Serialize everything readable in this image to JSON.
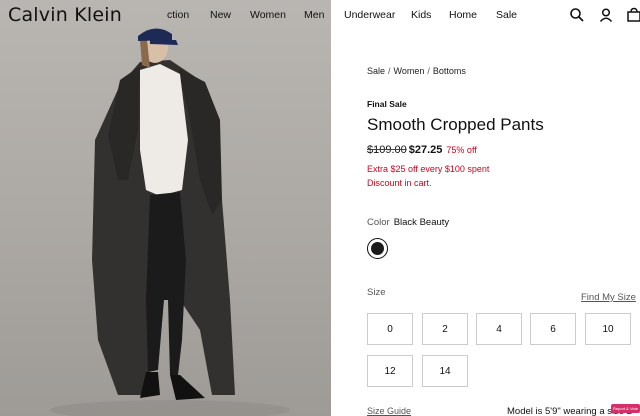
{
  "header": {
    "logo": "Calvin Klein",
    "nav": [
      "ction",
      "New",
      "Women",
      "Men",
      "Underwear",
      "Kids",
      "Home",
      "Sale"
    ]
  },
  "icons": {
    "search": "search-icon",
    "account": "user-icon",
    "cart": "bag-icon"
  },
  "product": {
    "breadcrumb": [
      "Sale",
      "Women",
      "Bottoms"
    ],
    "badge": "Final Sale",
    "title": "Smooth Cropped Pants",
    "price_old": "$109.00",
    "price_new": "$27.25",
    "discount": "75% off",
    "promo_line1": "Extra $25 off every $100 spent",
    "promo_line2": "Discount in cart.",
    "color_label": "Color",
    "color_value": "Black Beauty",
    "swatch_color": "#1a1a1a",
    "size_label": "Size",
    "find_size": "Find My Size",
    "sizes": [
      "0",
      "2",
      "4",
      "6",
      "10",
      "12",
      "14"
    ],
    "size_guide": "Size Guide",
    "model_info": "Model is 5'9\" wearing a size 2",
    "report_tag": "Report & Vote"
  },
  "colors": {
    "accent_red": "#d0021b",
    "text": "#111111"
  }
}
